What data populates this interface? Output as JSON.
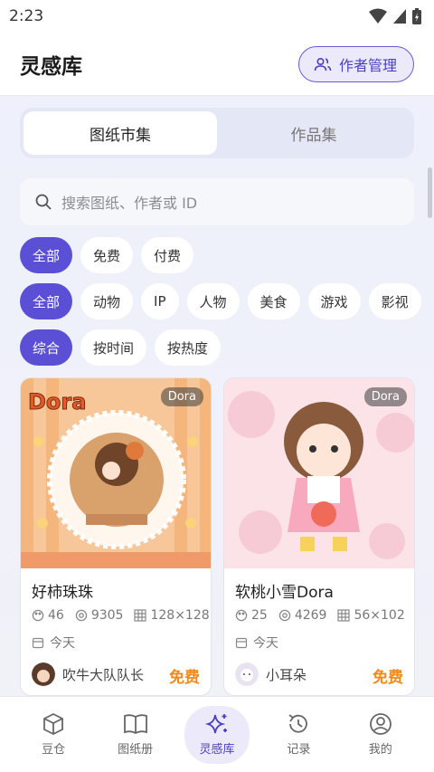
{
  "status_bar": {
    "time": "2:23",
    "icons": [
      "wifi-icon",
      "signal-icon",
      "battery-icon"
    ]
  },
  "header": {
    "title": "灵感库",
    "author_button": "作者管理"
  },
  "segmented": {
    "tabs": [
      "图纸市集",
      "作品集"
    ],
    "active": 0
  },
  "search": {
    "placeholder": "搜索图纸、作者或 ID"
  },
  "filters": {
    "price": [
      "全部",
      "免费",
      "付费"
    ],
    "category": [
      "全部",
      "动物",
      "IP",
      "人物",
      "美食",
      "游戏",
      "影视"
    ],
    "sort": [
      "综合",
      "按时间",
      "按热度"
    ]
  },
  "cards": [
    {
      "title": "好柿珠珠",
      "badge": "Dora",
      "colors": "46",
      "views": "9305",
      "size": "128×128",
      "date": "今天",
      "author": "吹牛大队队长",
      "price": "免费"
    },
    {
      "title": "软桃小雪Dora",
      "badge": "Dora",
      "colors": "25",
      "views": "4269",
      "size": "56×102",
      "date": "今天",
      "author": "小耳朵",
      "price": "免费"
    }
  ],
  "nav": {
    "items": [
      "豆仓",
      "图纸册",
      "灵感库",
      "记录",
      "我的"
    ],
    "active": 2
  },
  "colors": {
    "accent": "#5b4fd6",
    "price": "#f08a1c"
  }
}
